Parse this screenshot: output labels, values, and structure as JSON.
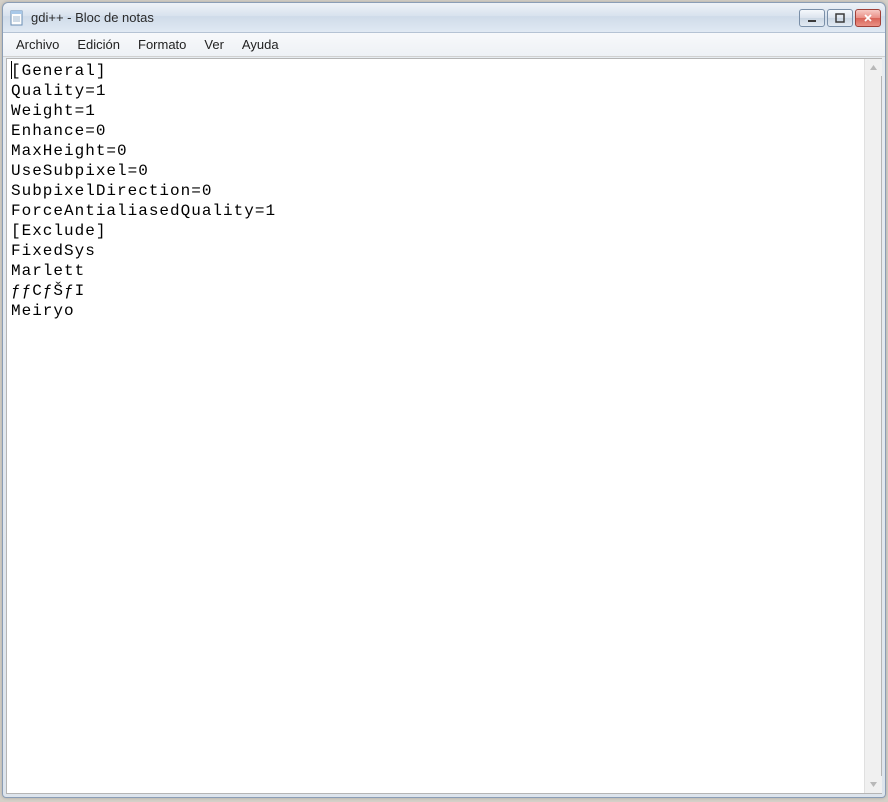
{
  "titlebar": {
    "title": "gdi++ - Bloc de notas"
  },
  "menubar": {
    "items": [
      "Archivo",
      "Edición",
      "Formato",
      "Ver",
      "Ayuda"
    ]
  },
  "editor": {
    "content": "[General]\nQuality=1\nWeight=1\nEnhance=0\nMaxHeight=0\nUseSubpixel=0\nSubpixelDirection=0\nForceAntialiasedQuality=1\n[Exclude]\nFixedSys\nMarlett\nƒƒCƒŠƒI\nMeiryo"
  }
}
